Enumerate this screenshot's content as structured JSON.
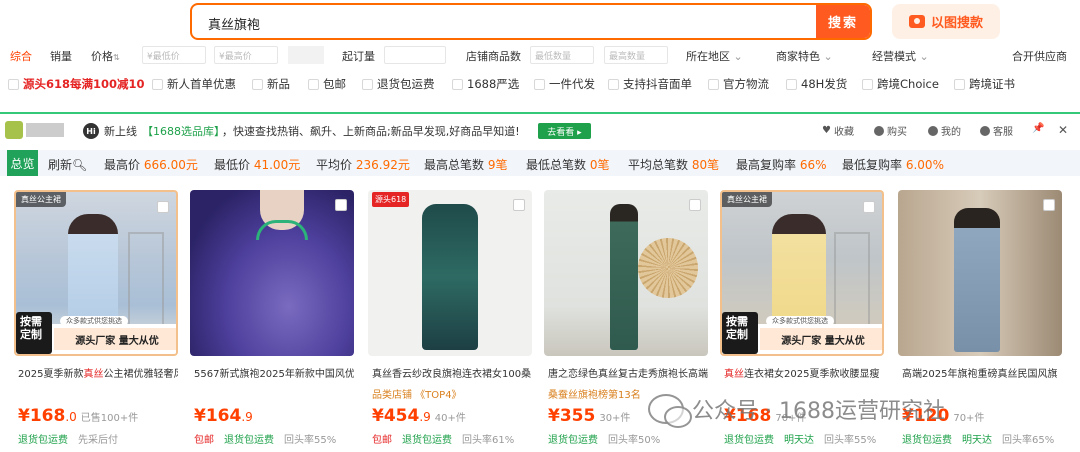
{
  "search": {
    "query": "真丝旗袍",
    "button": "搜索",
    "image_search": "以图搜款"
  },
  "filter_row1": {
    "sort_items": [
      "综合",
      "销量",
      "价格"
    ],
    "price_min_placeholder": "¥最低价",
    "price_max_placeholder": "¥最高价",
    "min_order": "起订量",
    "shop_reviews": "店铺商品数",
    "min_qty_placeholder": "最低数量",
    "max_qty_placeholder": "最高数量",
    "location": "所在地区",
    "merchant": "商家特色",
    "mode": "经营模式",
    "open_supply": "合开供应商"
  },
  "filter_row2": {
    "promo": "源头618每满100减10",
    "options": [
      "新人首单优惠",
      "新品",
      "包邮",
      "退货包运费",
      "1688严选",
      "一件代发",
      "支持抖音面单",
      "官方物流",
      "48H发货",
      "跨境Choice",
      "跨境证书"
    ]
  },
  "banner": {
    "hi": "Hi",
    "prefix": "新上线",
    "highlight": "【1688选品库】",
    "text": "，快速查找热销、飙升、上新商品;新品早发现,好商品早知道!",
    "go": "去看看 ▸",
    "tools": [
      "收藏",
      "购买",
      "我的",
      "客服"
    ]
  },
  "stats": {
    "overview": "总览",
    "refresh": "刷新",
    "items": [
      {
        "label": "最高价",
        "value": "666.00元"
      },
      {
        "label": "最低价",
        "value": "41.00元"
      },
      {
        "label": "平均价",
        "value": "236.92元"
      },
      {
        "label": "最高总笔数",
        "value": "9笔"
      },
      {
        "label": "最低总笔数",
        "value": "0笔"
      },
      {
        "label": "平均总笔数",
        "value": "80笔"
      },
      {
        "label": "最高复购率",
        "value": "66%"
      },
      {
        "label": "最低复购率",
        "value": "6.00%"
      }
    ]
  },
  "products": [
    {
      "title_pre": "2025夏季新款",
      "title_red": "真丝",
      "title_post": "公主裙优雅轻奢风",
      "corner": "真丝公主裙",
      "strip_left": "按需定制",
      "strip_right": "源头厂家 量大从优",
      "strip_sub": "众多款式供您挑选",
      "tag": "",
      "price_int": "¥168",
      "price_dec": ".0",
      "sold": "已售100+件",
      "foot": [
        "退货包运费",
        "先采后付"
      ]
    },
    {
      "title_pre": "5567新式旗袍2025年新款中国风优",
      "title_red": "",
      "title_post": "",
      "corner": "",
      "strip_left": "",
      "strip_right": "",
      "strip_sub": "",
      "tag": "",
      "price_int": "¥164",
      "price_dec": ".9",
      "sold": "",
      "foot": [
        "包邮",
        "退货包运费",
        "回头率55%"
      ]
    },
    {
      "title_pre": "真丝香云纱改良旗袍连衣裙女100桑",
      "title_red": "",
      "title_post": "",
      "corner": "源头618",
      "strip_left": "",
      "strip_right": "",
      "strip_sub": "",
      "tag": "品类店铺 《TOP4》",
      "price_int": "¥454",
      "price_dec": ".9",
      "sold": "40+件",
      "foot": [
        "包邮",
        "退货包运费",
        "回头率61%"
      ]
    },
    {
      "title_pre": "唐之恋绿色真丝复古走秀旗袍长高端",
      "title_red": "",
      "title_post": "",
      "corner": "",
      "strip_left": "",
      "strip_right": "",
      "strip_sub": "",
      "tag": "桑蚕丝旗袍榜第13名",
      "price_int": "¥355",
      "price_dec": "",
      "sold": "30+件",
      "foot": [
        "退货包运费",
        "回头率50%"
      ]
    },
    {
      "title_pre": "",
      "title_red": "真丝",
      "title_post": "连衣裙女2025夏季款收腰显瘦",
      "corner": "真丝公主裙",
      "strip_left": "按需定制",
      "strip_right": "源头厂家 量大从优",
      "strip_sub": "众多款式供您挑选",
      "tag": "",
      "price_int": "¥168",
      "price_dec": "",
      "sold": "70+件",
      "foot": [
        "退货包运费",
        "明天达",
        "回头率55%"
      ]
    },
    {
      "title_pre": "高端2025年旗袍重磅真丝民国风旗",
      "title_red": "",
      "title_post": "",
      "corner": "",
      "strip_left": "",
      "strip_right": "",
      "strip_sub": "",
      "tag": "",
      "price_int": "¥120",
      "price_dec": "",
      "sold": "70+件",
      "foot": [
        "退货包运费",
        "明天达",
        "回头率65%"
      ]
    }
  ],
  "watermark": "公众号 · 1688运营研究社",
  "colors": {
    "accent": "#ff6a00",
    "green": "#21a25a",
    "red": "#e52424"
  }
}
